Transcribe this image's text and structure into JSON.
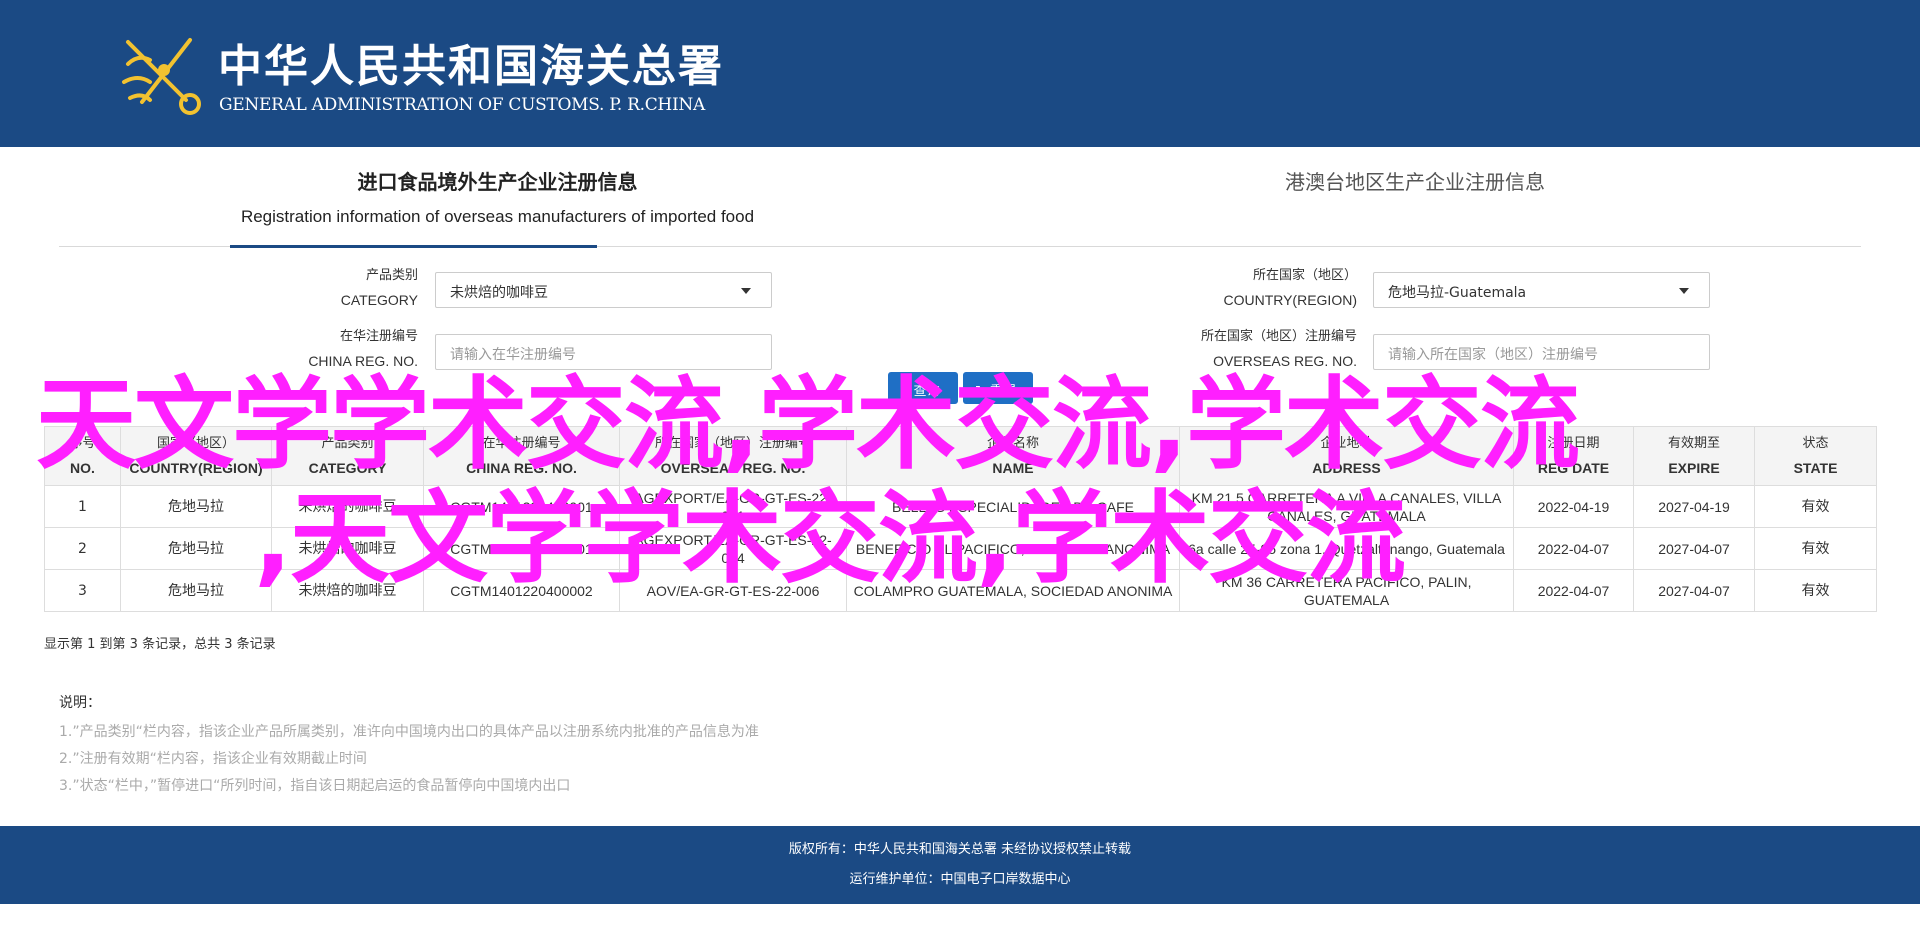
{
  "header": {
    "title_cn": "中华人民共和国海关总署",
    "title_en": "GENERAL ADMINISTRATION OF CUSTOMS. P. R.CHINA"
  },
  "tabs": [
    {
      "label_cn": "进口食品境外生产企业注册信息",
      "label_en": "Registration information of overseas manufacturers of imported food",
      "active": true
    },
    {
      "label_cn": "港澳台地区生产企业注册信息",
      "active": false
    }
  ],
  "form": {
    "category": {
      "label_cn": "产品类别",
      "label_en": "CATEGORY",
      "value": "未烘焙的咖啡豆"
    },
    "country": {
      "label_cn": "所在国家（地区）",
      "label_en": "COUNTRY(REGION)",
      "value": "危地马拉-Guatemala"
    },
    "china_reg": {
      "label_cn": "在华注册编号",
      "label_en": "CHINA REG. NO.",
      "placeholder": "请输入在华注册编号"
    },
    "overseas_reg": {
      "label_cn": "所在国家（地区）注册编号",
      "label_en": "OVERSEAS REG. NO.",
      "placeholder": "请输入所在国家（地区）注册编号"
    },
    "query_label": "查询",
    "reset_label": "重置"
  },
  "table": {
    "columns": [
      {
        "cn": "序号",
        "en": "NO."
      },
      {
        "cn": "国家（地区）",
        "en": "COUNTRY(REGION)"
      },
      {
        "cn": "产品类别",
        "en": "CATEGORY"
      },
      {
        "cn": "在华注册编号",
        "en": "CHINA REG. NO."
      },
      {
        "cn": "所在国家（地区）注册编号",
        "en": "OVERSEAS REG. NO."
      },
      {
        "cn": "企业名称",
        "en": "NAME"
      },
      {
        "cn": "企业地址",
        "en": "ADDRESS"
      },
      {
        "cn": "注册日期",
        "en": "REG DATE"
      },
      {
        "cn": "有效期至",
        "en": "EXPIRE"
      },
      {
        "cn": "状态",
        "en": "STATE"
      }
    ],
    "rows": [
      [
        "1",
        "危地马拉",
        "未烘焙的咖啡豆",
        "CGTM1401220400001",
        "AGEXPORT/EA-GR-GT-ES-22-001",
        "BELLAS ESPECIALIDADES DE CAFE",
        "KM 21.5 CARRETERA A VILLA CANALES, VILLA CANALES, GUATEMALA",
        "2022-04-19",
        "2027-04-19",
        "有效"
      ],
      [
        "2",
        "危地马拉",
        "未烘焙的咖啡豆",
        "CGTM1401220400001",
        "AGEXPORT/EA-GR-GT-ES-22-004",
        "BENEFICIO EL PACIFICO, SOCIEDAD ANONIMA",
        "6a calle 25-95 zona 1, Quetzaltenango, Guatemala",
        "2022-04-07",
        "2027-04-07",
        "有效"
      ],
      [
        "3",
        "危地马拉",
        "未烘焙的咖啡豆",
        "CGTM1401220400002",
        "AOV/EA-GR-GT-ES-22-006",
        "COLAMPRO GUATEMALA, SOCIEDAD ANONIMA",
        "KM 36 CARRETERA PACIFICO, PALIN, GUATEMALA",
        "2022-04-07",
        "2027-04-07",
        "有效"
      ]
    ]
  },
  "summary": "显示第 1 到第 3 条记录，总共 3 条记录",
  "notes": {
    "title": "说明：",
    "items": [
      "1.”产品类别“栏内容，指该企业产品所属类别，准许向中国境内出口的具体产品以注册系统内批准的产品信息为准",
      "2.”注册有效期“栏内容，指该企业有效期截止时间",
      "3.”状态“栏中，”暂停进口“所列时间，指自该日期起启运的食品暂停向中国境内出口"
    ]
  },
  "footer": {
    "copyright": "版权所有：中华人民共和国海关总署 未经协议授权禁止转载",
    "operator": "运行维护单位：中国电子口岸数据中心"
  },
  "watermark": {
    "line1": "天文学学术交流,学术交流,学术交流",
    "line2": ",天文学学术交流,学术交流"
  },
  "colors": {
    "header_bg": "#1b4a84",
    "button": "#1f6fc5",
    "watermark": "#ff1fff"
  }
}
